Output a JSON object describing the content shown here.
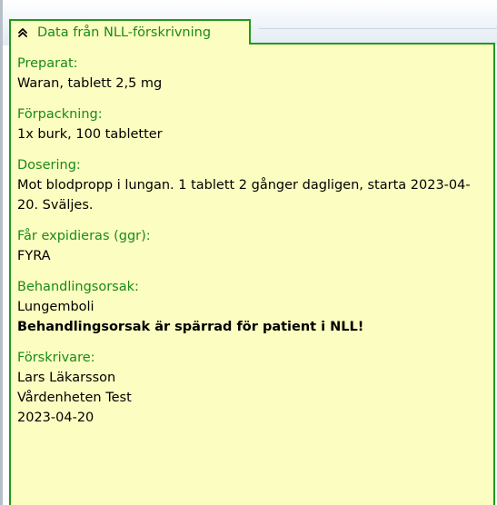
{
  "panel": {
    "title": "Data från NLL-förskrivning",
    "collapse_icon": "double-chevron-up-icon",
    "accent_color": "#1f9a1f",
    "label_color": "#1a8a1a",
    "background_color": "#fcfdc0"
  },
  "fields": {
    "preparat": {
      "label": "Preparat:",
      "value": "Waran, tablett 2,5 mg"
    },
    "forpackning": {
      "label": "Förpackning:",
      "value": "1x burk, 100 tabletter"
    },
    "dosering": {
      "label": "Dosering:",
      "value": "Mot blodpropp i lungan. 1 tablett 2 gånger dagligen, starta 2023-04-20. Sväljes."
    },
    "expidieras": {
      "label": "Får expidieras (ggr):",
      "value": "FYRA"
    },
    "behandlingsorsak": {
      "label": "Behandlingsorsak:",
      "value": "Lungemboli",
      "warning": "Behandlingsorsak är spärrad för patient i NLL!"
    },
    "forskrivare": {
      "label": "Förskrivare:",
      "name": "Lars Läkarsson",
      "unit": "Vårdenheten Test",
      "date": "2023-04-20"
    }
  }
}
